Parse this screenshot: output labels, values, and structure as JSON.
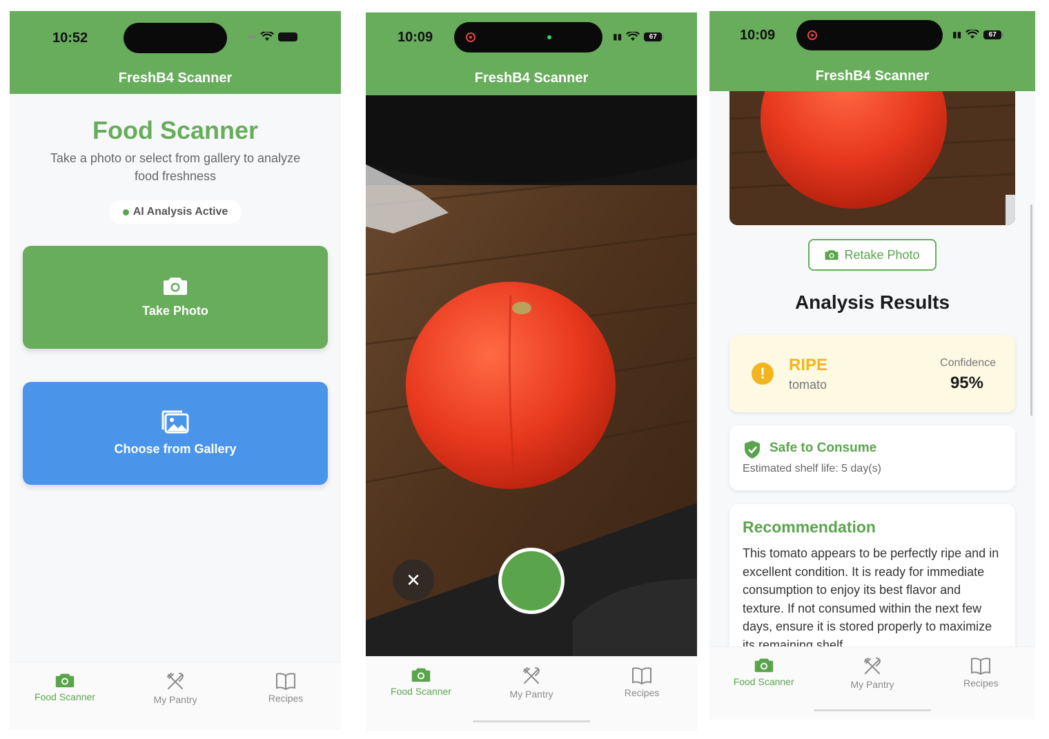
{
  "app_title": "FreshB4 Scanner",
  "colors": {
    "primary_green": "#67ad5b",
    "gallery_blue": "#4a94ea",
    "ripe_yellow": "#f2b51d"
  },
  "nav": [
    {
      "label": "Food Scanner",
      "icon": "camera-icon",
      "active": true
    },
    {
      "label": "My Pantry",
      "icon": "utensils-icon",
      "active": false
    },
    {
      "label": "Recipes",
      "icon": "book-icon",
      "active": false
    }
  ],
  "screen1": {
    "time": "10:52",
    "title": "Food Scanner",
    "subtitle": "Take a photo or select from gallery to analyze food freshness",
    "ai_status": "AI Analysis Active",
    "take_photo_label": "Take Photo",
    "gallery_label": "Choose from Gallery"
  },
  "screen2": {
    "time": "10:09",
    "battery": "67",
    "close_label": "✕"
  },
  "screen3": {
    "time": "10:09",
    "battery": "67",
    "retake_label": "Retake Photo",
    "results_title": "Analysis Results",
    "status": "RIPE",
    "food": "tomato",
    "confidence_label": "Confidence",
    "confidence_value": "95%",
    "safety_title": "Safe to Consume",
    "shelf_life": "Estimated shelf life: 5 day(s)",
    "recommendation_title": "Recommendation",
    "recommendation_text": "This tomato appears to be perfectly ripe and in excellent condition. It is ready for immediate consumption to enjoy its best flavor and texture. If not consumed within the next few days, ensure it is stored properly to maximize its remaining shelf"
  }
}
